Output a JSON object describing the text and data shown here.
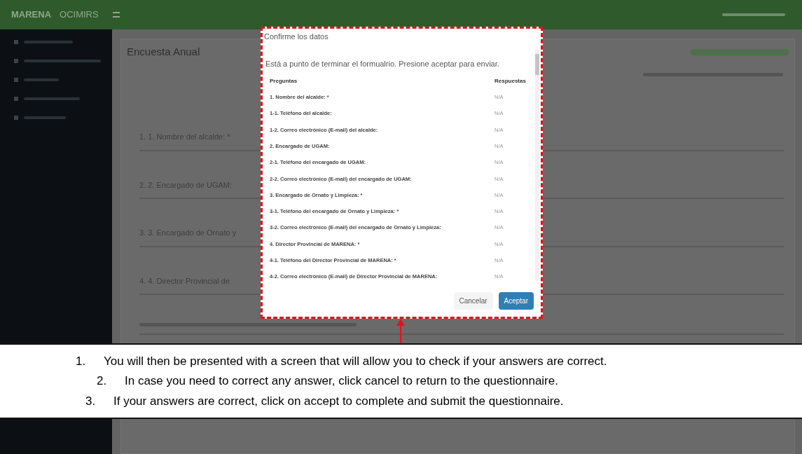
{
  "header": {
    "logo": "MARENA",
    "logo_sub": "OCIMIRS"
  },
  "page": {
    "title": "Encuesta Anual",
    "fields": [
      {
        "label": "1. 1. Nombre del alcalde: *"
      },
      {
        "label": "2. 2. Encargado de UGAM:"
      },
      {
        "label": "3. 3. Encargado de Ornato y"
      },
      {
        "label": "4. 4. Director Provincial de"
      }
    ]
  },
  "dialog": {
    "title": "Confirme los datos",
    "message": "Está a punto de terminar el formualrio. Presione aceptar para enviar.",
    "columns": [
      "Preguntas",
      "Respuestas"
    ],
    "rows": [
      {
        "question": "1. Nombre del alcalde: *",
        "answer": "N/A"
      },
      {
        "question": "1-1. Teléfono del alcalde:",
        "answer": "N/A"
      },
      {
        "question": "1-2. Correo electrónico (E-mail) del alcalde:",
        "answer": "N/A"
      },
      {
        "question": "2. Encargado de UGAM:",
        "answer": "N/A"
      },
      {
        "question": "2-1. Teléfono del encargado de UGAM:",
        "answer": "N/A"
      },
      {
        "question": "2-2. Correo electrónico (E-mail) del encargado de UGAM:",
        "answer": "N/A"
      },
      {
        "question": "3. Encargado de Ornato y Limpieza: *",
        "answer": "N/A"
      },
      {
        "question": "3-1. Teléfono del encargado de Ornato y Limpieza: *",
        "answer": "N/A"
      },
      {
        "question": "3-2. Correo electrónico (E-mail) del encargado de Ornato y Limpieza:",
        "answer": "N/A"
      },
      {
        "question": "4. Director Provincial de MARENA: *",
        "answer": "N/A"
      },
      {
        "question": "4-1. Teléfono del Director Provincial de MARENA: *",
        "answer": "N/A"
      },
      {
        "question": "4-2. Correo electrónico (E-mail) de Director Provincial de MARENA:",
        "answer": "N/A"
      }
    ],
    "buttons": [
      {
        "label": "Cancelar",
        "kind": "secondary"
      },
      {
        "label": "Aceptar",
        "kind": "primary"
      }
    ]
  },
  "instructions": [
    {
      "number": "1.",
      "text": "You will then be presented with a screen that will allow you to check if your answers are correct."
    },
    {
      "number": "2.",
      "text": "In case you need to correct any answer, click cancel to return to the questionnaire."
    },
    {
      "number": "3.",
      "text": "If your answers are correct, click on accept to complete and submit the questionnaire."
    }
  ]
}
